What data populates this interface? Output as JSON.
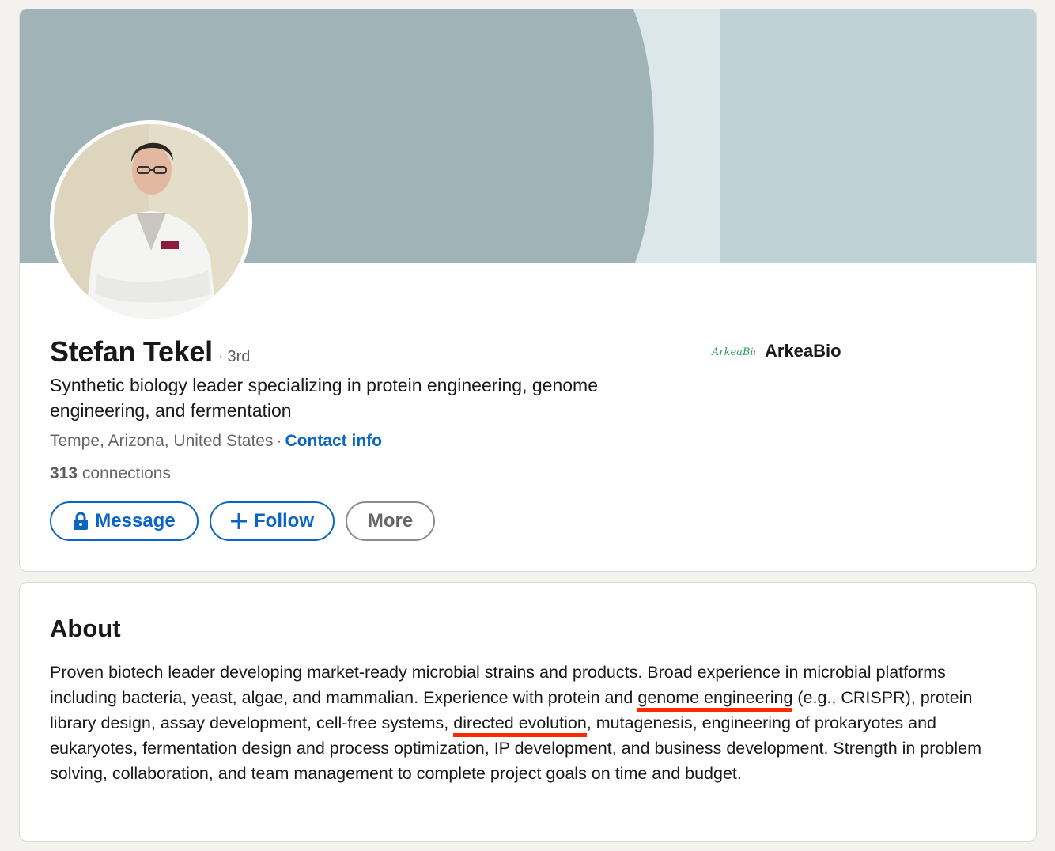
{
  "profile": {
    "name": "Stefan Tekel",
    "degree_separator": "·",
    "degree": "3rd",
    "headline": "Synthetic biology leader specializing in protein engineering, genome engineering, and fermentation",
    "location": "Tempe, Arizona, United States",
    "location_separator": "·",
    "contact_info_label": "Contact info",
    "connections_count": "313",
    "connections_label": "connections"
  },
  "company": {
    "logo_text": "ArkeaBio",
    "name": "ArkeaBio"
  },
  "actions": {
    "message_label": "Message",
    "follow_label": "Follow",
    "more_label": "More"
  },
  "about": {
    "title": "About",
    "text_part1": "Proven biotech leader developing market-ready microbial strains and products. Broad experience in microbial platforms including bacteria, yeast, algae, and mammalian. Experience with protein and ",
    "highlight1": "genome engineering",
    "text_part2": " (e.g., CRISPR), protein library design, assay development, cell-free systems, ",
    "highlight2": "directed evolution",
    "text_part3": ", mutagenesis, engineering of prokaryotes and eukaryotes, fermentation design and process optimization, IP development, and business development. Strength in problem solving, collaboration, and team management to complete project goals on time and budget."
  },
  "colors": {
    "accent": "#0a66c2",
    "annotation_underline": "#ff2a00",
    "banner_dark": "#a0b3b6",
    "banner_light": "#dbe7e8",
    "banner_right": "#bfd3d6"
  },
  "icons": {
    "message": "lock-icon",
    "follow": "plus-icon"
  }
}
